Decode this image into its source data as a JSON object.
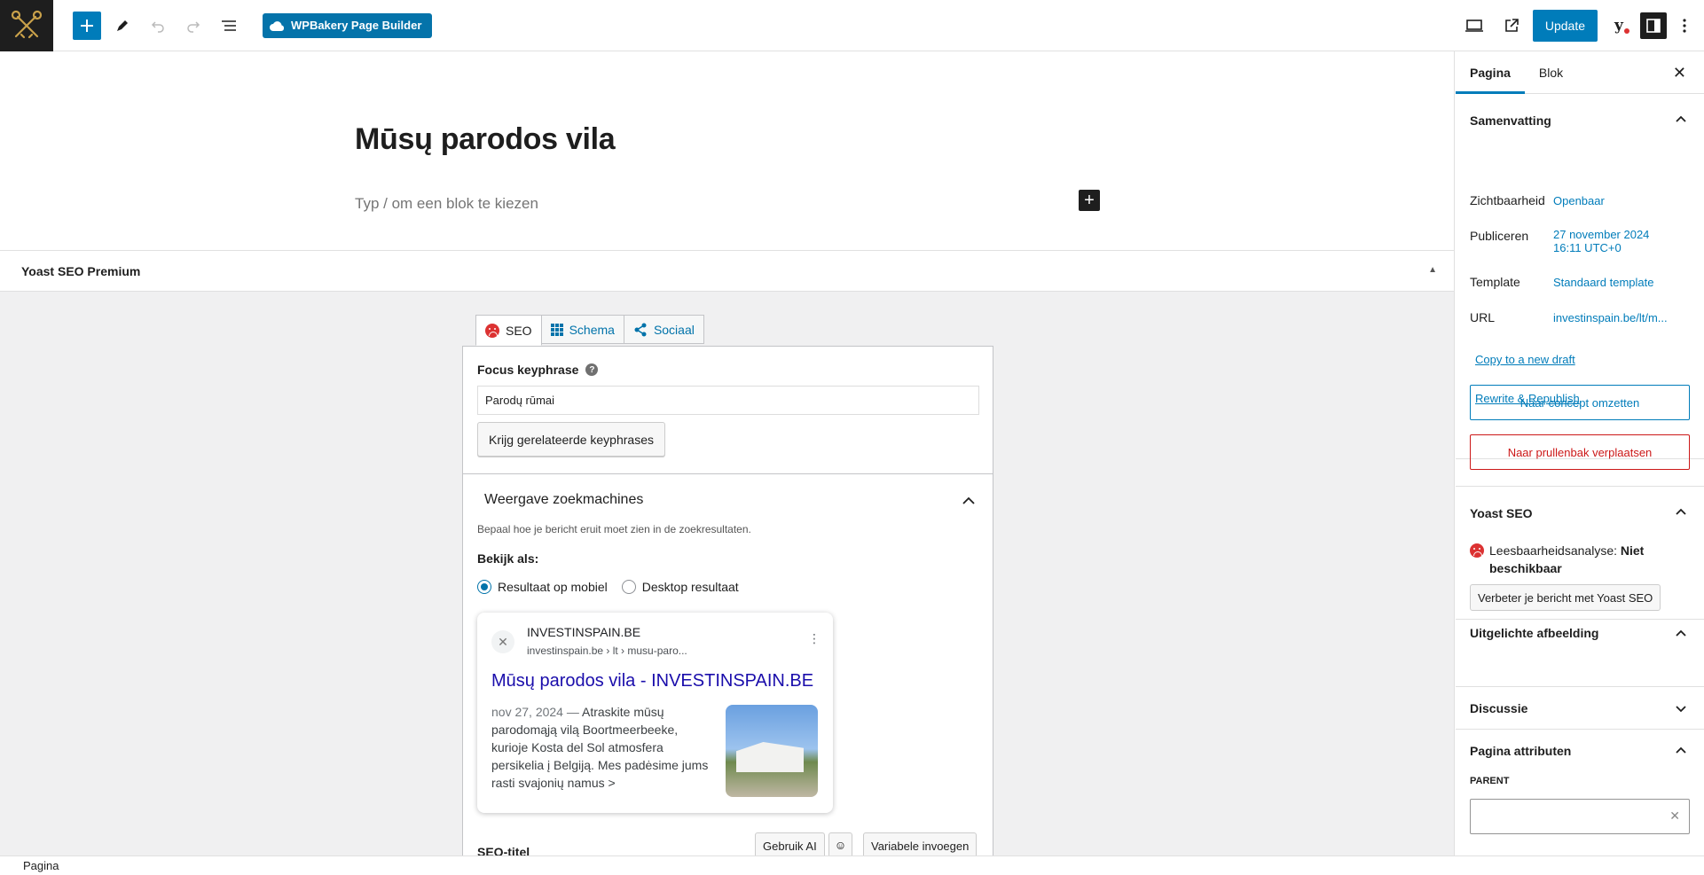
{
  "toolbar": {
    "wpbakery_label": "WPBakery Page Builder",
    "update_label": "Update"
  },
  "editor": {
    "title": "Mūsų parodos vila",
    "block_placeholder": "Typ / om een blok te kiezen"
  },
  "yoast": {
    "header": "Yoast SEO Premium",
    "tabs": [
      {
        "label": "SEO"
      },
      {
        "label": "Schema"
      },
      {
        "label": "Sociaal"
      }
    ],
    "focus_keyphrase_label": "Focus keyphrase",
    "focus_keyphrase_value": "Parodų rūmai",
    "related_button": "Krijg gerelateerde keyphrases",
    "search_appearance_title": "Weergave zoekmachines",
    "search_appearance_desc": "Bepaal hoe je bericht eruit moet zien in de zoekresultaten.",
    "view_as_label": "Bekijk als:",
    "radio_mobile": "Resultaat op mobiel",
    "radio_desktop": "Desktop resultaat",
    "serp": {
      "site_name": "INVESTINSPAIN.BE",
      "site_url": "investinspain.be › lt › musu-paro...",
      "link_title": "Mūsų parodos vila - INVESTINSPAIN.BE",
      "date": "nov 27, 2024",
      "snippet": "Atraskite mūsų parodomąją vilą Boortmeerbeeke, kurioje Kosta del Sol atmosfera persikelia į Belgiją. Mes padėsime jums rasti svajonių namus >"
    },
    "seo_title_label": "SEO-titel",
    "use_ai_button": "Gebruik AI",
    "insert_variable_button": "Variabele invoegen"
  },
  "statusbar": {
    "breadcrumb": "Pagina"
  },
  "sidebar": {
    "tab_page": "Pagina",
    "tab_block": "Blok",
    "summary_title": "Samenvatting",
    "rows": [
      {
        "label": "Zichtbaarheid",
        "value": "Openbaar"
      },
      {
        "label": "Publiceren",
        "value": "27 november 2024 16:11 UTC+0"
      },
      {
        "label": "Template",
        "value": "Standaard template"
      },
      {
        "label": "URL",
        "value": "investinspain.be/lt/m..."
      }
    ],
    "copy_draft_link": "Copy to a new draft",
    "rewrite_link": "Rewrite & Republish",
    "to_draft_button": "Naar concept omzetten",
    "to_trash_button": "Naar prullenbak verplaatsen",
    "yoast_title": "Yoast SEO",
    "readability_label": "Leesbaarheidsanalyse: ",
    "readability_value": "Niet beschikbaar",
    "improve_button": "Verbeter je bericht met Yoast SEO",
    "featured_image_title": "Uitgelichte afbeelding",
    "discussion_title": "Discussie",
    "page_attributes_title": "Pagina attributen",
    "parent_label": "PARENT"
  }
}
